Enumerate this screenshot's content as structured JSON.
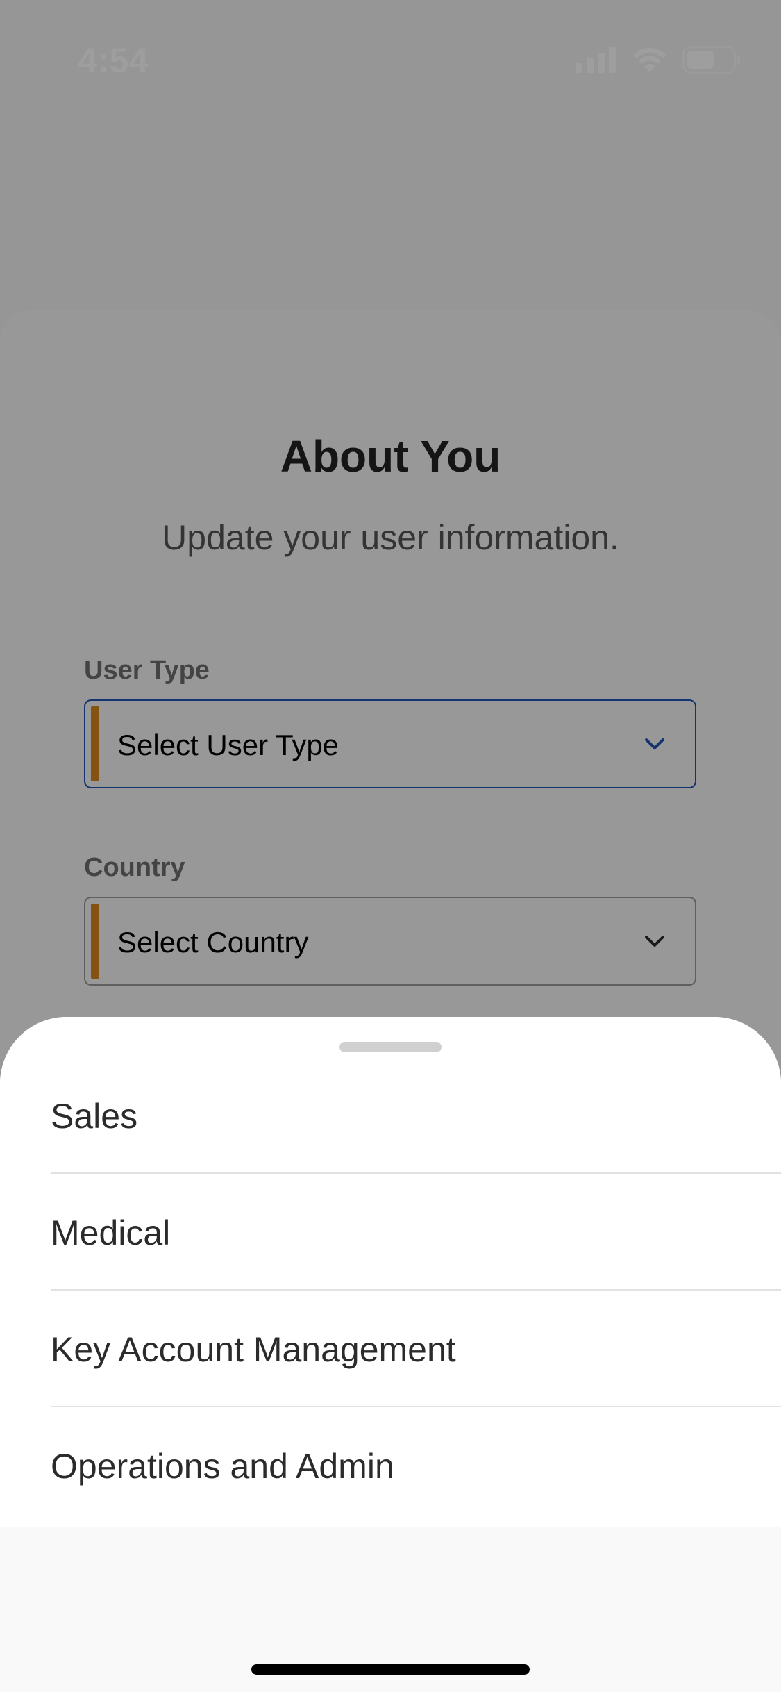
{
  "status_bar": {
    "time": "4:54"
  },
  "header": {
    "title": "About You",
    "subtitle": "Update your user information."
  },
  "form": {
    "user_type": {
      "label": "User Type",
      "value": "Select User Type"
    },
    "country": {
      "label": "Country",
      "value": "Select Country"
    }
  },
  "sheet": {
    "options": [
      {
        "label": "Sales"
      },
      {
        "label": "Medical"
      },
      {
        "label": "Key Account Management"
      },
      {
        "label": "Operations and Admin"
      }
    ]
  },
  "colors": {
    "accent": "#d7871c",
    "focus_border": "#1f55b3",
    "overlay": "rgba(0,0,0,0.38)"
  },
  "icons": [
    "cellular-signal-icon",
    "wifi-icon",
    "battery-icon",
    "chevron-down-icon"
  ]
}
